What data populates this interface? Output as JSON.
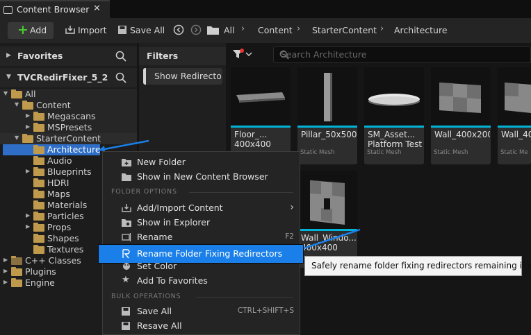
{
  "tab": {
    "title": "Content Browser",
    "close": "✕"
  },
  "toolbar": {
    "add": "Add",
    "import": "Import",
    "save_all": "Save All"
  },
  "breadcrumb": [
    "All",
    "Content",
    "StarterContent",
    "Architecture"
  ],
  "panels": {
    "favorites": "Favorites",
    "project": "TVCRedirFixer_5_2",
    "filters": "Filters"
  },
  "filter_chip": "Show Redirectors",
  "search": {
    "placeholder": "Search Architecture"
  },
  "tree": [
    {
      "label": "All"
    },
    {
      "label": "Content"
    },
    {
      "label": "Megascans"
    },
    {
      "label": "MSPresets"
    },
    {
      "label": "StarterContent"
    },
    {
      "label": "Architecture"
    },
    {
      "label": "Audio"
    },
    {
      "label": "Blueprints"
    },
    {
      "label": "HDRI"
    },
    {
      "label": "Maps"
    },
    {
      "label": "Materials"
    },
    {
      "label": "Particles"
    },
    {
      "label": "Props"
    },
    {
      "label": "Shapes"
    },
    {
      "label": "Textures"
    },
    {
      "label": "C++ Classes"
    },
    {
      "label": "Plugins"
    },
    {
      "label": "Engine"
    }
  ],
  "assets": [
    {
      "name1": "Floor_...",
      "name2": "400x400",
      "type": ""
    },
    {
      "name1": "Pillar_50x500",
      "name2": "",
      "type": "Static Mesh"
    },
    {
      "name1": "SM_Asset...",
      "name2": "Platform Test",
      "type": "Static Mesh"
    },
    {
      "name1": "Wall_400x200",
      "name2": "",
      "type": "Static Mesh"
    },
    {
      "name1": "Wall_40",
      "name2": "",
      "type": "Static Me"
    },
    {
      "name1": "Wall_Windo...",
      "name2": "400x400",
      "type": ""
    }
  ],
  "context_menu": {
    "items_top": [
      "New Folder",
      "Show in New Content Browser"
    ],
    "section_folder": "FOLDER OPTIONS",
    "items_folder": [
      "Add/Import Content",
      "Show in Explorer",
      "Rename",
      "Rename Folder Fixing Redirectors",
      "Set Color",
      "Add To Favorites"
    ],
    "rename_shortcut": "F2",
    "section_bulk": "BULK OPERATIONS",
    "items_bulk": [
      "Save All",
      "Resave All"
    ],
    "save_shortcut": "CTRL+SHIFT+S"
  },
  "tooltip": "Safely rename folder fixing redirectors remaining if any",
  "colors": {
    "accent": "#00b4d8",
    "highlight": "#1a7fe8",
    "folder": "#c09a4c",
    "add_plus": "#47c72f"
  }
}
